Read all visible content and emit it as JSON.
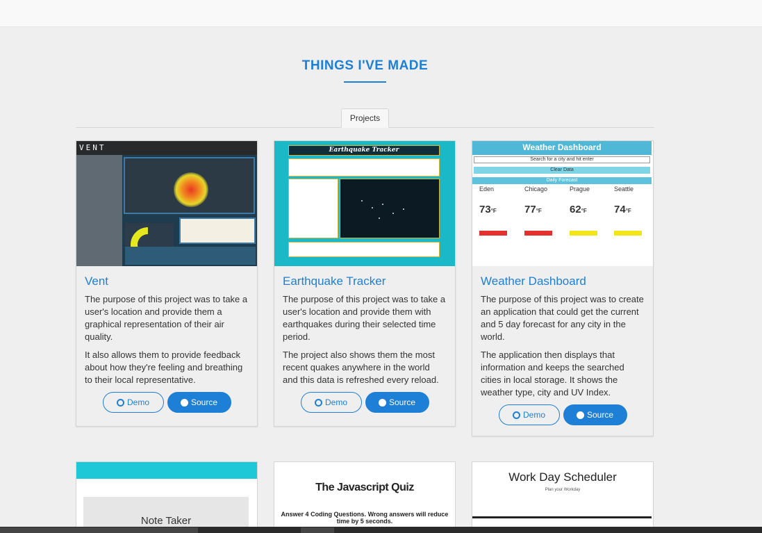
{
  "section": {
    "title": "THINGS I'VE MADE"
  },
  "tabs": [
    {
      "label": "Projects"
    }
  ],
  "projects": [
    {
      "title": "Vent",
      "paragraphs": [
        "The purpose of this project was to take a user's location and provide them a graphical representation of their air quality.",
        "It also allows them to provide feedback about how they're feeling and breathing to their local representative."
      ],
      "demo_label": "Demo",
      "source_label": "Source",
      "thumb": {
        "header": "VENT"
      }
    },
    {
      "title": "Earthquake Tracker",
      "paragraphs": [
        "The purpose of this project was to take a user's location and provide them with earthquakes during their selected time period.",
        "The project also shows them the most recent quakes anywhere in the world and this data is refreshed every reload."
      ],
      "demo_label": "Demo",
      "source_label": "Source",
      "thumb": {
        "header": "Earthquake Tracker"
      }
    },
    {
      "title": "Weather Dashboard",
      "paragraphs": [
        "The purpose of this project was to create an application that could get the current and 5 day forecast for any city in the world.",
        "The application then displays that information and keeps the searched cities in local storage. It shows the weather type, city and UV Index."
      ],
      "demo_label": "Demo",
      "source_label": "Source",
      "thumb": {
        "header": "Weather Dashboard",
        "search": "Search for a city and hit enter",
        "clear": "Clear Data",
        "forecast": "Daily Forecast",
        "cities": [
          {
            "name": "Eden",
            "temp": "73",
            "uv_color": "#e53030"
          },
          {
            "name": "Chicago",
            "temp": "77",
            "uv_color": "#e53030"
          },
          {
            "name": "Prague",
            "temp": "62",
            "uv_color": "#f2e61a"
          },
          {
            "name": "Seattle",
            "temp": "74",
            "uv_color": "#f2e61a"
          }
        ],
        "unit": "°F"
      }
    }
  ],
  "more_projects": [
    {
      "thumb_title": "Note Taker"
    },
    {
      "thumb_title": "The Javascript Quiz",
      "thumb_subtitle": "Answer 4 Coding Questions. Wrong answers will reduce time by 5 seconds."
    },
    {
      "thumb_title": "Work Day Scheduler",
      "thumb_subtitle": "Plan your Workday"
    }
  ]
}
